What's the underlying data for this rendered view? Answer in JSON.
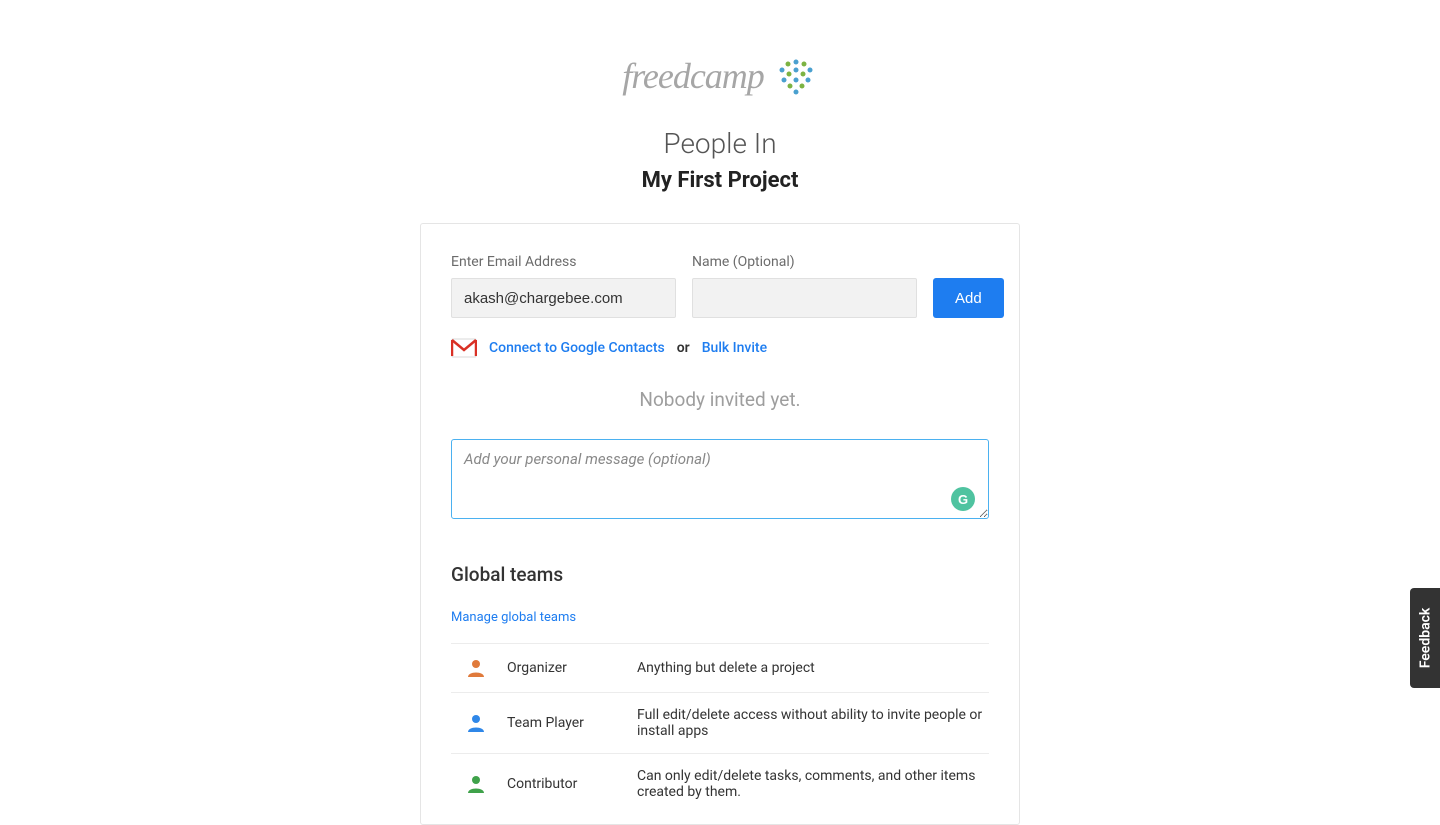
{
  "header": {
    "brand": "freedcamp",
    "page_title": "People In",
    "project_name": "My First Project"
  },
  "form": {
    "email_label": "Enter Email Address",
    "email_value": "akash@chargebee.com",
    "name_label": "Name (Optional)",
    "name_value": "",
    "add_button": "Add",
    "connect_google": "Connect to Google Contacts",
    "or_text": "or",
    "bulk_invite": "Bulk Invite",
    "nobody_text": "Nobody invited yet.",
    "message_placeholder": "Add your personal message (optional)"
  },
  "teams": {
    "section_title": "Global teams",
    "manage_link": "Manage global teams",
    "roles": [
      {
        "name": "Organizer",
        "desc": "Anything but delete a project",
        "color": "#e07a3b"
      },
      {
        "name": "Team Player",
        "desc": "Full edit/delete access without ability to invite people or install apps",
        "color": "#2f87e8"
      },
      {
        "name": "Contributor",
        "desc": "Can only edit/delete tasks, comments, and other items created by them.",
        "color": "#3fa24a"
      }
    ]
  },
  "feedback": {
    "label": "Feedback"
  }
}
